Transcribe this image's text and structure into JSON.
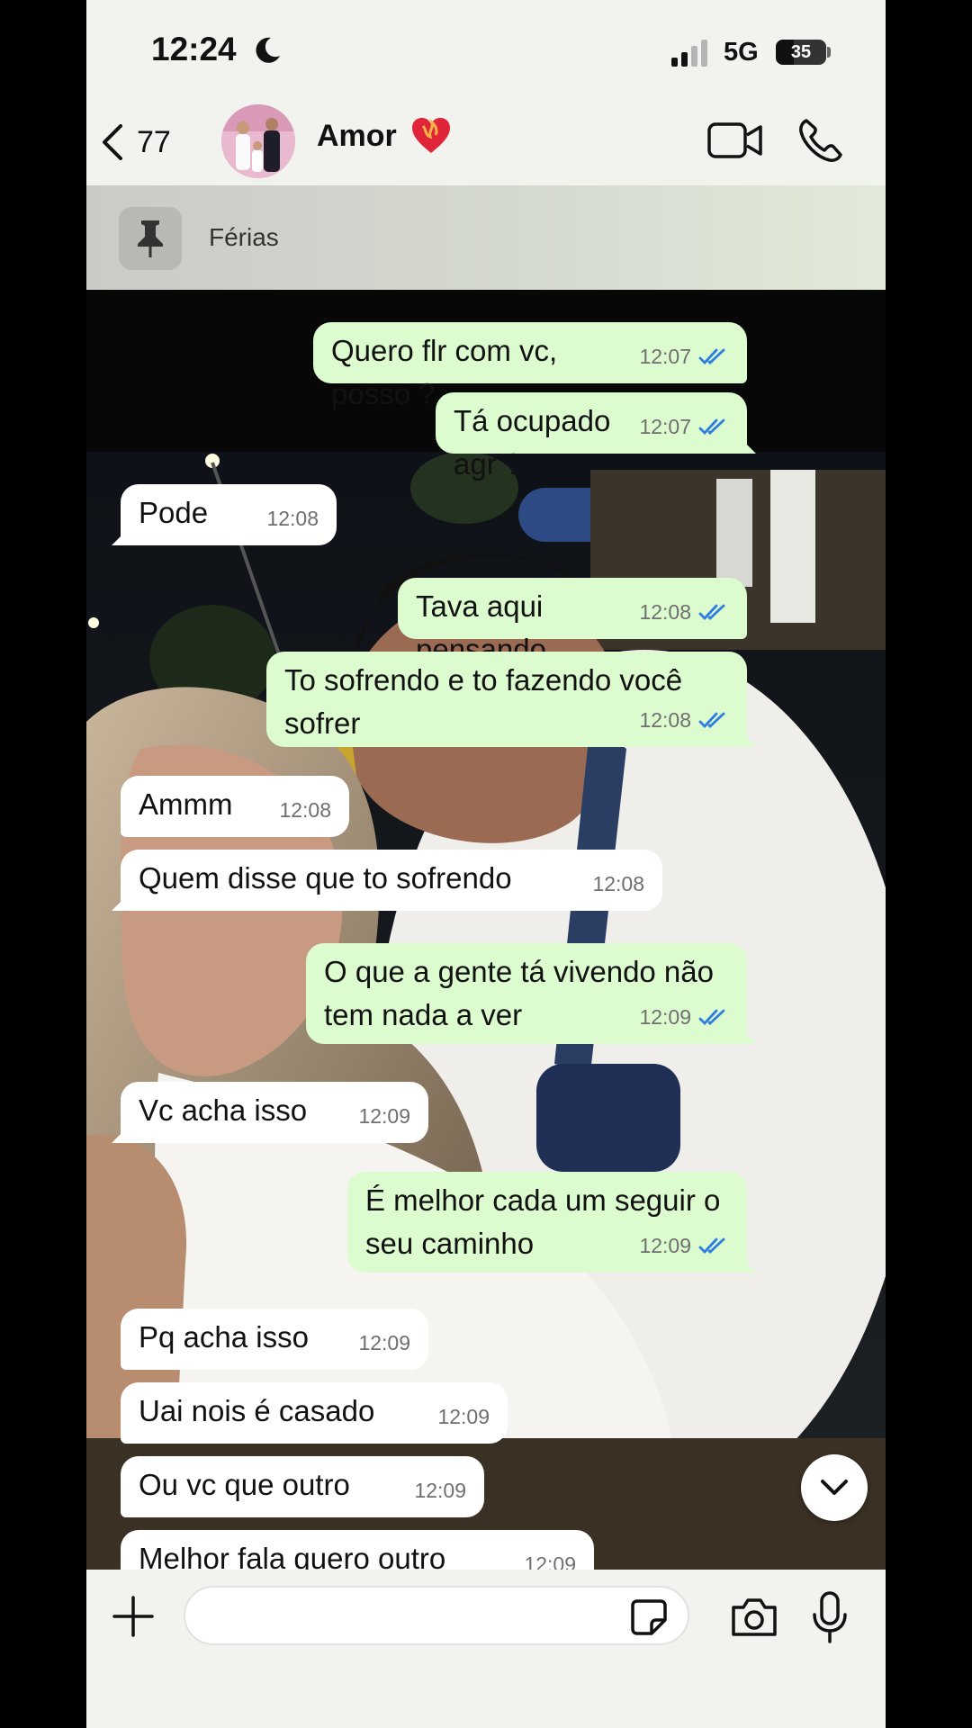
{
  "status_bar": {
    "time": "12:24",
    "network": "5G",
    "battery": "35",
    "icons": [
      "moon-icon",
      "signal-icon",
      "battery-icon"
    ]
  },
  "header": {
    "back_count": "77",
    "contact_name": "Amor",
    "icons": [
      "back-chevron-icon",
      "heart-emoji-icon",
      "video-call-icon",
      "phone-icon"
    ]
  },
  "pinned": {
    "label": "Férias",
    "icon": "pin-icon"
  },
  "messages": [
    {
      "text": "Quero flr com vc, posso ?",
      "time": "12:07",
      "dir": "out"
    },
    {
      "text": "Tá ocupado agr ?",
      "time": "12:07",
      "dir": "out"
    },
    {
      "text": "Pode",
      "time": "12:08",
      "dir": "in"
    },
    {
      "text": "Tava aqui pensando",
      "time": "12:08",
      "dir": "out"
    },
    {
      "text": "To sofrendo e to fazendo você sofrer",
      "time": "12:08",
      "dir": "out"
    },
    {
      "text": "Ammm",
      "time": "12:08",
      "dir": "in"
    },
    {
      "text": "Quem disse que to sofrendo",
      "time": "12:08",
      "dir": "in"
    },
    {
      "text": "O que a gente tá vivendo não tem nada a ver",
      "time": "12:09",
      "dir": "out"
    },
    {
      "text": "Vc acha isso",
      "time": "12:09",
      "dir": "in"
    },
    {
      "text": "É melhor cada um seguir o seu caminho",
      "time": "12:09",
      "dir": "out"
    },
    {
      "text": "Pq acha isso",
      "time": "12:09",
      "dir": "in"
    },
    {
      "text": "Uai nois é casado",
      "time": "12:09",
      "dir": "in"
    },
    {
      "text": "Ou vc que outro",
      "time": "12:09",
      "dir": "in"
    },
    {
      "text": "Melhor fala quero outro",
      "time": "12:09",
      "dir": "in"
    }
  ],
  "input": {
    "placeholder": "",
    "icons": [
      "plus-icon",
      "sticker-icon",
      "camera-icon",
      "microphone-icon"
    ]
  },
  "colors": {
    "outgoing_bubble": "#dcfcd0",
    "incoming_bubble": "#ffffff",
    "read_ticks": "#2e7de1",
    "bar_background": "#f2f2ef"
  }
}
